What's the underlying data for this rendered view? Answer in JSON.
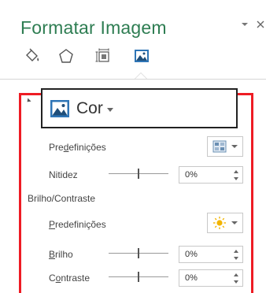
{
  "pane": {
    "title": "Formatar Imagem"
  },
  "tabs": [
    {
      "icon": "fill-line-icon"
    },
    {
      "icon": "effects-icon"
    },
    {
      "icon": "size-properties-icon"
    },
    {
      "icon": "picture-icon",
      "active": true
    }
  ],
  "section": {
    "title": "Cor",
    "icon": "picture-icon"
  },
  "rows": {
    "predef1_pre": "Pre",
    "predef1_acc": "d",
    "predef1_post": "efinições",
    "nitidez_label": "Nitidez",
    "nitidez_value": "0%",
    "nitidez_level": 0.5,
    "subsection_label": "Brilho/Contraste",
    "predef2_acc": "P",
    "predef2_post": "redefinições",
    "brilho_acc": "B",
    "brilho_post": "rilho",
    "brilho_value": "0%",
    "brilho_level": 0.5,
    "contraste_pre": "C",
    "contraste_acc": "o",
    "contraste_post": "ntraste",
    "contraste_value": "0%",
    "contraste_level": 0.5
  },
  "colors": {
    "title": "#2e7d52",
    "highlight_border": "#ee1c24",
    "accent_blue": "#2e75b6",
    "sun": "#f2b400"
  }
}
